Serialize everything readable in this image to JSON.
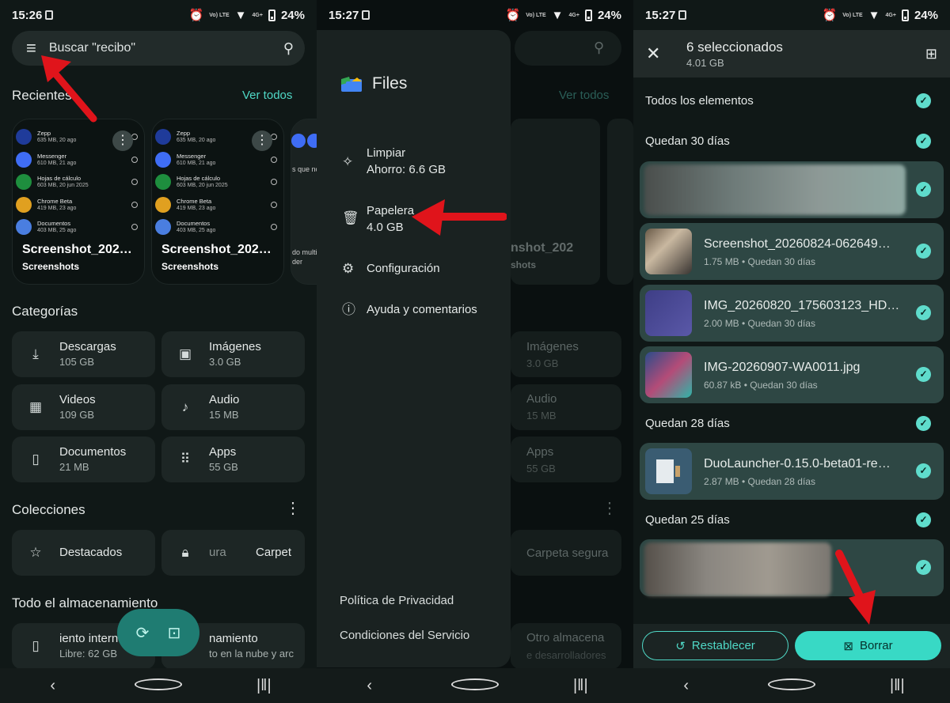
{
  "status": {
    "p1_time": "15:26",
    "p2_time": "15:27",
    "p3_time": "15:27",
    "battery": "24%",
    "volte": "Vo) LTE",
    "net": "4G+"
  },
  "home": {
    "search_placeholder": "Buscar \"recibo\"",
    "recents_title": "Recientes",
    "see_all": "Ver todos",
    "thumb_rows": [
      {
        "name": "Zepp",
        "meta": "635 MB, 20 ago",
        "color": "#1f3b9a"
      },
      {
        "name": "Messenger",
        "meta": "610 MB, 21 ago",
        "color": "#3f6df5"
      },
      {
        "name": "Hojas de cálculo",
        "meta": "603 MB, 20 jun 2025",
        "color": "#1e8e3e"
      },
      {
        "name": "Chrome Beta",
        "meta": "419 MB, 23 ago",
        "color": "#e0a020"
      },
      {
        "name": "Documentos",
        "meta": "403 MB, 25 ago",
        "color": "#4a7ee0"
      }
    ],
    "thumb_caption": "Screenshot_202…",
    "thumb_folder": "Screenshots",
    "thumb3_text1": "s que no",
    "thumb3_text2": "do multi",
    "thumb3_text3": "der",
    "categories_title": "Categorías",
    "categories": [
      {
        "name": "Descargas",
        "size": "105 GB",
        "icon": "download-icon"
      },
      {
        "name": "Imágenes",
        "size": "3.0 GB",
        "icon": "image-icon"
      },
      {
        "name": "Videos",
        "size": "109 GB",
        "icon": "video-icon"
      },
      {
        "name": "Audio",
        "size": "15 MB",
        "icon": "music-icon"
      },
      {
        "name": "Documentos",
        "size": "21 MB",
        "icon": "document-icon"
      },
      {
        "name": "Apps",
        "size": "55 GB",
        "icon": "apps-icon"
      }
    ],
    "collections_title": "Colecciones",
    "favorites": "Destacados",
    "secure_partial": "ura",
    "secure_folder_partial": "Carpet",
    "storage_title": "Todo el almacenamiento",
    "internal_name": "iento intern",
    "internal_free": "Libre: 62 GB",
    "other_name": "namiento",
    "other_sub": "to en la nube y arc"
  },
  "drawer": {
    "app_name": "Files",
    "items": [
      {
        "title": "Limpiar",
        "sub": "Ahorro: 6.6 GB",
        "icon": "sparkle-icon"
      },
      {
        "title": "Papelera",
        "sub": "4.0 GB",
        "icon": "trash-icon"
      },
      {
        "title": "Configuración",
        "sub": "",
        "icon": "gear-icon"
      },
      {
        "title": "Ayuda y comentarios",
        "sub": "",
        "icon": "help-icon"
      }
    ],
    "privacy": "Política de Privacidad",
    "terms": "Condiciones del Servicio",
    "bg_see_all": "Ver todos",
    "bg_caption": "nshot_202",
    "bg_folder": "shots",
    "bg_images": "Imágenes",
    "bg_images_size": "3.0 GB",
    "bg_audio": "Audio",
    "bg_audio_size": "15 MB",
    "bg_apps": "Apps",
    "bg_apps_size": "55 GB",
    "bg_secure": "Carpeta segura",
    "bg_other": "Otro almacena",
    "bg_other_sub": "e desarrolladores"
  },
  "trash": {
    "selected": "6 seleccionados",
    "selected_size": "4.01 GB",
    "all_items": "Todos los elementos",
    "sec30": "Quedan 30 días",
    "sec28": "Quedan 28 días",
    "sec25": "Quedan 25 días",
    "files": [
      {
        "name": "",
        "meta": ""
      },
      {
        "name": "Screenshot_20260824-062649…",
        "meta": "1.75 MB • Quedan 30 días"
      },
      {
        "name": "IMG_20260820_175603123_HD…",
        "meta": "2.00 MB • Quedan 30 días"
      },
      {
        "name": "IMG-20260907-WA0011.jpg",
        "meta": "60.87 kB • Quedan 30 días"
      },
      {
        "name": "DuoLauncher-0.15.0-beta01-re…",
        "meta": "2.87 MB • Quedan 28 días"
      },
      {
        "name": "",
        "meta": ""
      }
    ],
    "restore": "Restablecer",
    "delete": "Borrar"
  },
  "colors": {
    "accent": "#4fd8c6",
    "bg": "#101817",
    "card": "#1d2625",
    "arrow": "#e0141b"
  }
}
